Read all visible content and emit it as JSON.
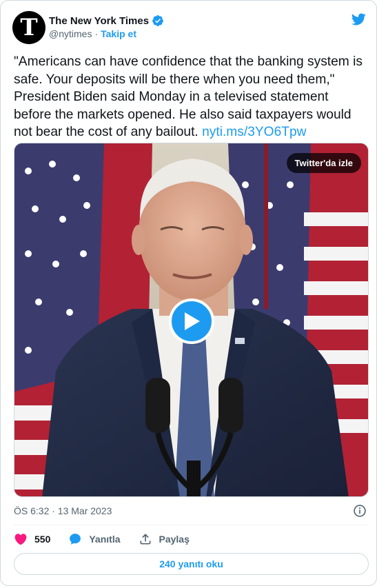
{
  "author": {
    "name": "The New York Times",
    "handle": "@nytimes",
    "separator": "·",
    "follow_label": "Takip et",
    "avatar_glyph": "T"
  },
  "tweet": {
    "text": "\"Americans can have confidence that the banking system is safe. Your deposits will be there when you need them,\" President Biden said Monday in a televised statement before the markets opened. He also said taxpayers would not bear the cost of any bailout.",
    "link": "nyti.ms/3YO6Tpw"
  },
  "media": {
    "watch_label": "Twitter'da izle",
    "play_icon": "play-icon"
  },
  "meta": {
    "timestamp": "ÖS 6:32 · 13 Mar 2023"
  },
  "actions": {
    "likes_count": "550",
    "reply_label": "Yanıtla",
    "share_label": "Paylaş"
  },
  "replies_button_label": "240 yanıtı oku",
  "colors": {
    "accent": "#1d9bf0",
    "like": "#f91880",
    "text": "#0f1419",
    "muted": "#536471"
  }
}
